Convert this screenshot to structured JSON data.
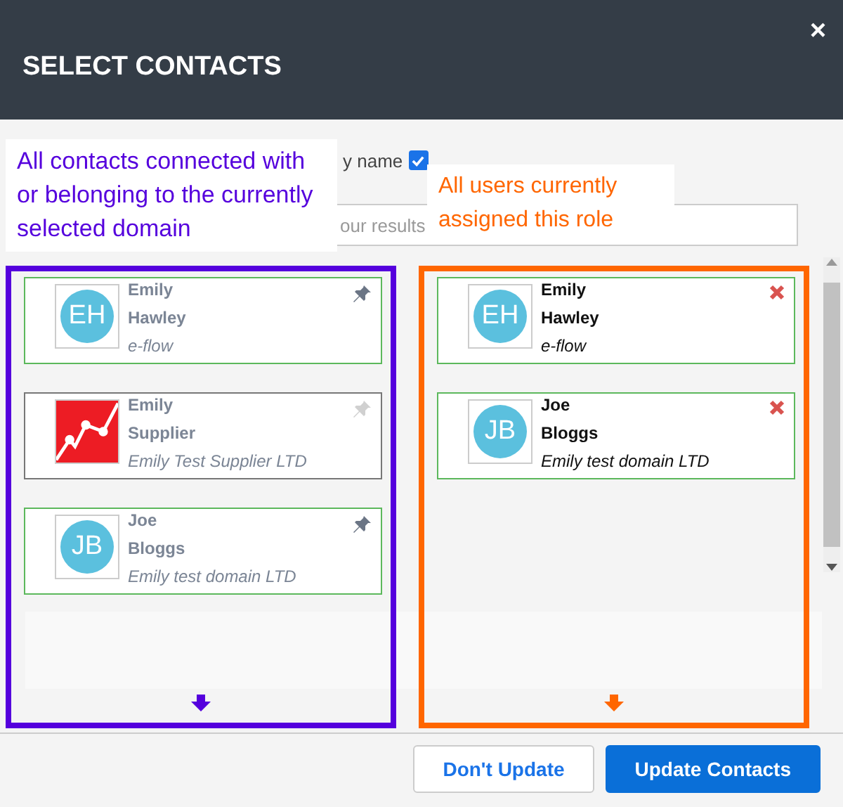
{
  "dialog": {
    "title": "SELECT CONTACTS",
    "close": "×"
  },
  "filter": {
    "label": "y name",
    "checked": true
  },
  "search": {
    "placeholder": "our results"
  },
  "annotations": [
    {
      "text": "All contacts connected with or belonging to the currently selected domain",
      "color": "#5500dd"
    },
    {
      "text": "All users currently assigned this role",
      "color": "#ff6600"
    }
  ],
  "columns": [
    {
      "kind": "available",
      "color": "#5500dd",
      "items": [
        {
          "first": "Emily",
          "last": "Hawley",
          "company": "e-flow",
          "avatar": {
            "kind": "initials",
            "text": "EH"
          },
          "pinned": true
        },
        {
          "first": "Emily",
          "last": "Supplier",
          "company": "Emily Test Supplier LTD",
          "avatar": {
            "kind": "logo"
          },
          "pinned": false
        },
        {
          "first": "Joe",
          "last": "Bloggs",
          "company": "Emily test domain LTD",
          "avatar": {
            "kind": "initials",
            "text": "JB"
          },
          "pinned": true
        }
      ]
    },
    {
      "kind": "assigned",
      "color": "#ff6600",
      "items": [
        {
          "first": "Emily",
          "last": "Hawley",
          "company": "e-flow",
          "avatar": {
            "kind": "initials",
            "text": "EH"
          }
        },
        {
          "first": "Joe",
          "last": "Bloggs",
          "company": "Emily test domain LTD",
          "avatar": {
            "kind": "initials",
            "text": "JB"
          }
        }
      ]
    }
  ],
  "buttons": [
    {
      "label": "Don't Update",
      "kind": "secondary"
    },
    {
      "label": "Update Contacts",
      "kind": "primary"
    }
  ]
}
